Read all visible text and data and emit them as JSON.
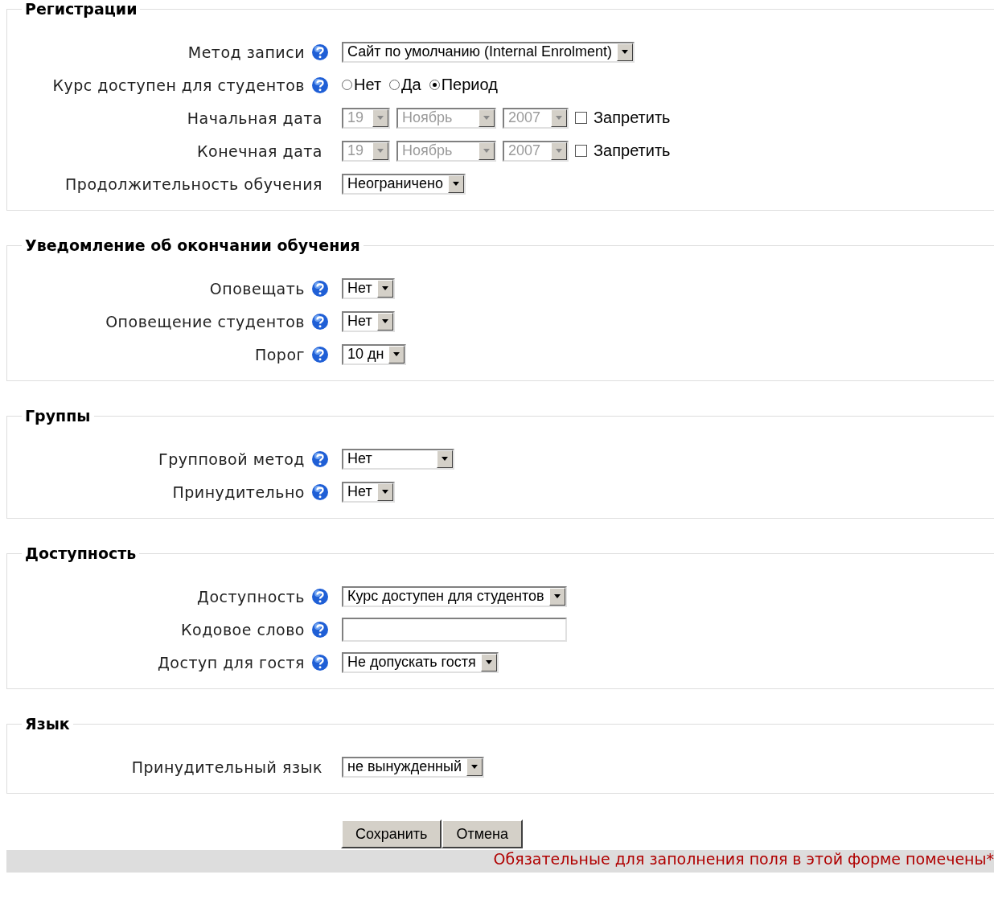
{
  "sections": [
    {
      "title": "Регистрации",
      "rows": [
        {
          "kind": "select",
          "label": "Метод записи",
          "help": true,
          "value": "Сайт по умолчанию (Internal Enrolment)"
        },
        {
          "kind": "radio",
          "label": "Курс доступен для студентов",
          "help": true,
          "options": [
            {
              "label": "Нет",
              "selected": false
            },
            {
              "label": "Да",
              "selected": false
            },
            {
              "label": "Период",
              "selected": true
            }
          ]
        },
        {
          "kind": "date",
          "label": "Начальная дата",
          "help": false,
          "day": "19",
          "month": "Ноябрь",
          "year": "2007",
          "disabled": true,
          "checkbox": {
            "label": "Запретить",
            "checked": false
          }
        },
        {
          "kind": "date",
          "label": "Конечная дата",
          "help": false,
          "day": "19",
          "month": "Ноябрь",
          "year": "2007",
          "disabled": true,
          "checkbox": {
            "label": "Запретить",
            "checked": false
          }
        },
        {
          "kind": "select",
          "label": "Продолжительность обучения",
          "help": false,
          "value": "Неограничено"
        }
      ]
    },
    {
      "title": "Уведомление об окончании обучения",
      "rows": [
        {
          "kind": "select",
          "label": "Оповещать",
          "help": true,
          "value": "Нет"
        },
        {
          "kind": "select",
          "label": "Оповещение студентов",
          "help": true,
          "value": "Нет"
        },
        {
          "kind": "select",
          "label": "Порог",
          "help": true,
          "value": "10 дн"
        }
      ]
    },
    {
      "title": "Группы",
      "rows": [
        {
          "kind": "select",
          "label": "Групповой метод",
          "help": true,
          "value": "Нет",
          "wide": true
        },
        {
          "kind": "select",
          "label": "Принудительно",
          "help": true,
          "value": "Нет"
        }
      ]
    },
    {
      "title": "Доступность",
      "rows": [
        {
          "kind": "select",
          "label": "Доступность",
          "help": true,
          "value": "Курс доступен для студентов",
          "wide": true
        },
        {
          "kind": "text",
          "label": "Кодовое слово",
          "help": true
        },
        {
          "kind": "select",
          "label": "Доступ для гостя",
          "help": true,
          "value": "Не допускать гостя",
          "wide": true
        }
      ]
    },
    {
      "title": "Язык",
      "rows": [
        {
          "kind": "select",
          "label": "Принудительный язык",
          "help": false,
          "value": "не вынужденный"
        }
      ]
    }
  ],
  "buttons": [
    "Сохранить",
    "Отмена"
  ],
  "required_note": "Обязательные для заполнения поля в этой форме помечены*"
}
